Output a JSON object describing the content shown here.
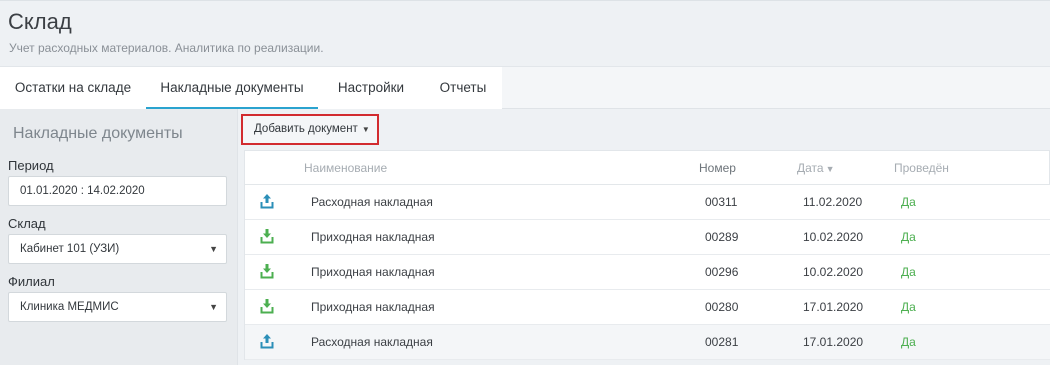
{
  "header": {
    "title": "Склад",
    "subtitle": "Учет расходных материалов. Аналитика по реализации."
  },
  "tabs": [
    {
      "label": "Остатки на складе",
      "active": false
    },
    {
      "label": "Накладные документы",
      "active": true
    },
    {
      "label": "Настройки",
      "active": false
    },
    {
      "label": "Отчеты",
      "active": false
    }
  ],
  "sidebar": {
    "title": "Накладные документы",
    "period_label": "Период",
    "period_value": "01.01.2020  :  14.02.2020",
    "warehouse_label": "Склад",
    "warehouse_value": "Кабинет 101 (УЗИ)",
    "branch_label": "Филиал",
    "branch_value": "Клиника МЕДМИС"
  },
  "toolbar": {
    "add_document_label": "Добавить документ"
  },
  "table": {
    "columns": {
      "name": "Наименование",
      "number": "Номер",
      "date": "Дата",
      "posted": "Проведён"
    },
    "rows": [
      {
        "name": "Расходная накладная",
        "number": "00311",
        "date": "11.02.2020",
        "posted": "Да",
        "icon": "upload-icon"
      },
      {
        "name": "Приходная накладная",
        "number": "00289",
        "date": "10.02.2020",
        "posted": "Да",
        "icon": "download-icon"
      },
      {
        "name": "Приходная накладная",
        "number": "00296",
        "date": "10.02.2020",
        "posted": "Да",
        "icon": "download-icon"
      },
      {
        "name": "Приходная накладная",
        "number": "00280",
        "date": "17.01.2020",
        "posted": "Да",
        "icon": "download-icon"
      },
      {
        "name": "Расходная накладная",
        "number": "00281",
        "date": "17.01.2020",
        "posted": "Да",
        "icon": "upload-icon"
      }
    ]
  },
  "colors": {
    "accent": "#2aa3cf",
    "incoming": "#4caf50",
    "outgoing": "#2b8fb8",
    "highlight_border": "#d22b2f",
    "posted": "#4caf50"
  }
}
